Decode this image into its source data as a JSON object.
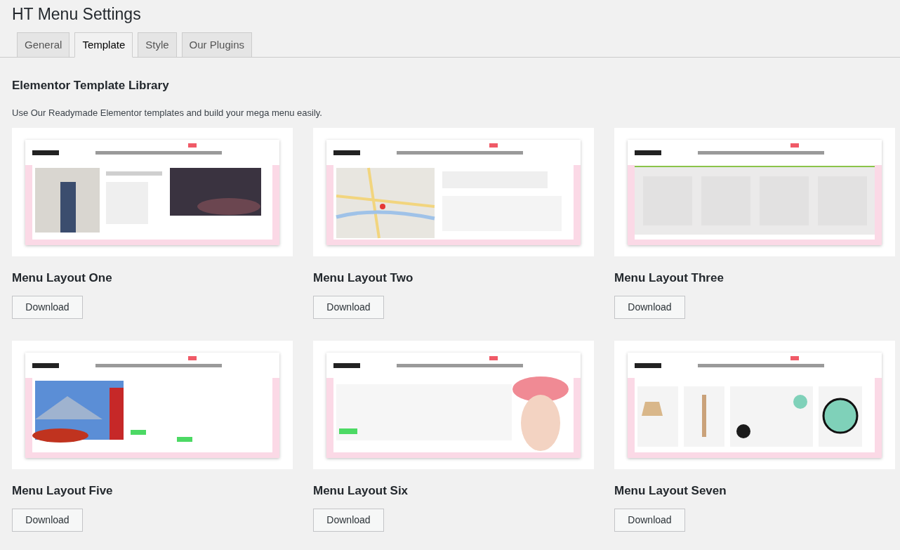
{
  "page_title": "HT Menu Settings",
  "tabs": [
    {
      "label": "General",
      "selected": false
    },
    {
      "label": "Template",
      "selected": true
    },
    {
      "label": "Style",
      "selected": false
    },
    {
      "label": "Our Plugins",
      "selected": false
    }
  ],
  "section": {
    "heading": "Elementor Template Library",
    "description": "Use Our Readymade Elementor templates and build your mega menu easily."
  },
  "templates": [
    {
      "title": "Menu Layout One",
      "button": "Download"
    },
    {
      "title": "Menu Layout Two",
      "button": "Download"
    },
    {
      "title": "Menu Layout Three",
      "button": "Download"
    },
    {
      "title": "Menu Layout Five",
      "button": "Download"
    },
    {
      "title": "Menu Layout Six",
      "button": "Download"
    },
    {
      "title": "Menu Layout Seven",
      "button": "Download"
    }
  ]
}
